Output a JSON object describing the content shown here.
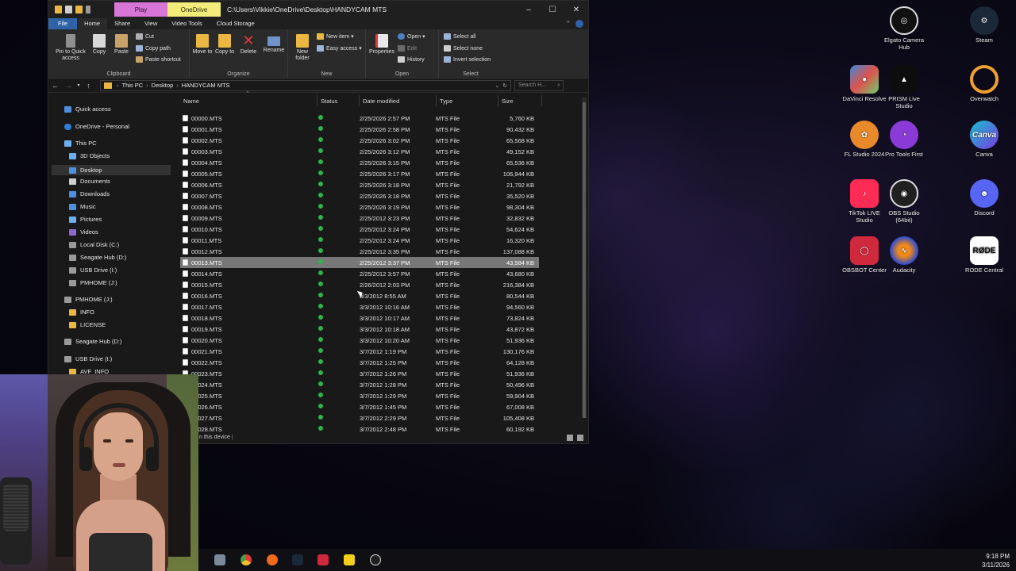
{
  "window": {
    "path_title": "C:\\Users\\Vikkie\\OneDrive\\Desktop\\HANDYCAM MTS",
    "tool_tabs": [
      "Play",
      "OneDrive"
    ],
    "controls": [
      "–",
      "☐",
      "✕"
    ]
  },
  "ribbon_tabs": [
    "File",
    "Home",
    "Share",
    "View",
    "Video Tools",
    "Cloud Storage"
  ],
  "ribbon": {
    "clipboard": {
      "pin": "Pin to Quick access",
      "copy": "Copy",
      "paste": "Paste",
      "cut": "Cut",
      "copy_path": "Copy path",
      "paste_shortcut": "Paste shortcut",
      "label": "Clipboard"
    },
    "organize": {
      "move_to": "Move to",
      "copy_to": "Copy to",
      "delete": "Delete",
      "rename": "Rename",
      "label": "Organize"
    },
    "new": {
      "new_folder": "New folder",
      "new_item": "New item ▾",
      "easy_access": "Easy access ▾",
      "label": "New"
    },
    "open": {
      "properties": "Properties",
      "open": "Open ▾",
      "edit": "Edit",
      "history": "History",
      "label": "Open"
    },
    "select": {
      "select_all": "Select all",
      "select_none": "Select none",
      "invert": "Invert selection",
      "label": "Select"
    }
  },
  "address": {
    "crumbs": [
      "This PC",
      "Desktop",
      "HANDYCAM MTS"
    ],
    "search_placeholder": "Search H..."
  },
  "nav": {
    "quick_access": "Quick access",
    "onedrive": "OneDrive - Personal",
    "this_pc": "This PC",
    "objects3d": "3D Objects",
    "desktop": "Desktop",
    "documents": "Documents",
    "downloads": "Downloads",
    "music": "Music",
    "pictures": "Pictures",
    "videos": "Videos",
    "local_disk": "Local Disk (C:)",
    "seagate1": "Seagate Hub  (D:)",
    "usb1": "USB Drive (I:)",
    "pmhome1": "PMHOME (J:)",
    "pmhome2": "PMHOME (J:)",
    "info": "INFO",
    "license": "LICENSE",
    "seagate2": "Seagate Hub  (D:)",
    "usb2": "USB Drive (I:)",
    "avf": "AVF_INFO"
  },
  "columns": {
    "name": "Name",
    "status": "Status",
    "date": "Date modified",
    "type": "Type",
    "size": "Size"
  },
  "files": [
    {
      "name": "00000.MTS",
      "date": "2/25/2026 2:57 PM",
      "type": "MTS File",
      "size": "5,760 KB"
    },
    {
      "name": "00001.MTS",
      "date": "2/25/2026 2:58 PM",
      "type": "MTS File",
      "size": "90,432 KB"
    },
    {
      "name": "00002.MTS",
      "date": "2/25/2026 3:02 PM",
      "type": "MTS File",
      "size": "65,568 KB"
    },
    {
      "name": "00003.MTS",
      "date": "2/25/2026 3:12 PM",
      "type": "MTS File",
      "size": "49,152 KB"
    },
    {
      "name": "00004.MTS",
      "date": "2/25/2026 3:15 PM",
      "type": "MTS File",
      "size": "65,536 KB"
    },
    {
      "name": "00005.MTS",
      "date": "2/25/2026 3:17 PM",
      "type": "MTS File",
      "size": "106,944 KB"
    },
    {
      "name": "00006.MTS",
      "date": "2/25/2026 3:18 PM",
      "type": "MTS File",
      "size": "21,792 KB"
    },
    {
      "name": "00007.MTS",
      "date": "2/25/2026 3:18 PM",
      "type": "MTS File",
      "size": "35,520 KB"
    },
    {
      "name": "00008.MTS",
      "date": "2/25/2026 3:19 PM",
      "type": "MTS File",
      "size": "98,304 KB"
    },
    {
      "name": "00009.MTS",
      "date": "2/25/2012 3:23 PM",
      "type": "MTS File",
      "size": "32,832 KB"
    },
    {
      "name": "00010.MTS",
      "date": "2/25/2012 3:24 PM",
      "type": "MTS File",
      "size": "54,624 KB"
    },
    {
      "name": "00011.MTS",
      "date": "2/25/2012 3:24 PM",
      "type": "MTS File",
      "size": "16,320 KB"
    },
    {
      "name": "00012.MTS",
      "date": "2/25/2012 3:35 PM",
      "type": "MTS File",
      "size": "137,088 KB"
    },
    {
      "name": "00013.MTS",
      "date": "2/25/2012 3:37 PM",
      "type": "MTS File",
      "size": "43,584 KB"
    },
    {
      "name": "00014.MTS",
      "date": "2/25/2012 3:57 PM",
      "type": "MTS File",
      "size": "43,680 KB"
    },
    {
      "name": "00015.MTS",
      "date": "2/26/2012 2:03 PM",
      "type": "MTS File",
      "size": "216,384 KB"
    },
    {
      "name": "00016.MTS",
      "date": "3/3/2012 8:55 AM",
      "type": "MTS File",
      "size": "80,544 KB"
    },
    {
      "name": "00017.MTS",
      "date": "3/3/2012 10:16 AM",
      "type": "MTS File",
      "size": "94,560 KB"
    },
    {
      "name": "00018.MTS",
      "date": "3/3/2012 10:17 AM",
      "type": "MTS File",
      "size": "73,824 KB"
    },
    {
      "name": "00019.MTS",
      "date": "3/3/2012 10:18 AM",
      "type": "MTS File",
      "size": "43,872 KB"
    },
    {
      "name": "00020.MTS",
      "date": "3/3/2012 10:20 AM",
      "type": "MTS File",
      "size": "51,936 KB"
    },
    {
      "name": "00021.MTS",
      "date": "3/7/2012 1:19 PM",
      "type": "MTS File",
      "size": "130,176 KB"
    },
    {
      "name": "00022.MTS",
      "date": "3/7/2012 1:25 PM",
      "type": "MTS File",
      "size": "64,128 KB"
    },
    {
      "name": "00023.MTS",
      "date": "3/7/2012 1:26 PM",
      "type": "MTS File",
      "size": "51,936 KB"
    },
    {
      "name": "00024.MTS",
      "date": "3/7/2012 1:28 PM",
      "type": "MTS File",
      "size": "50,496 KB"
    },
    {
      "name": "00025.MTS",
      "date": "3/7/2012 1:29 PM",
      "type": "MTS File",
      "size": "59,904 KB"
    },
    {
      "name": "00026.MTS",
      "date": "3/7/2012 1:45 PM",
      "type": "MTS File",
      "size": "67,008 KB"
    },
    {
      "name": "00027.MTS",
      "date": "3/7/2012 2:29 PM",
      "type": "MTS File",
      "size": "105,408 KB"
    },
    {
      "name": "00028.MTS",
      "date": "3/7/2012 2:48 PM",
      "type": "MTS File",
      "size": "60,192 KB"
    }
  ],
  "selected_file": "00013.MTS",
  "status_text": "n this device",
  "desktop_icons": {
    "elgato": "Elgato Camera Hub",
    "steam": "Steam",
    "davinci": "DaVinci Resolve",
    "prism": "PRISM Live Studio",
    "overwatch": "Overwatch",
    "fl": "FL Studio 2024",
    "protools": "Pro Tools First",
    "canva": "Canva",
    "tiktok": "TikTok LIVE Studio",
    "obs": "OBS Studio (64bit)",
    "discord": "Discord",
    "obsbot": "OBSBOT Center",
    "audacity": "Audacity",
    "rode": "RODE Central",
    "canva_glyph": "Canva",
    "rode_glyph": "RØDE"
  },
  "clock": {
    "time": "9:18 PM",
    "date": "3/11/2026"
  },
  "colors": {
    "accent": "#2e63a8",
    "status_ok": "#2fb34a",
    "selected_row": "#777777"
  }
}
